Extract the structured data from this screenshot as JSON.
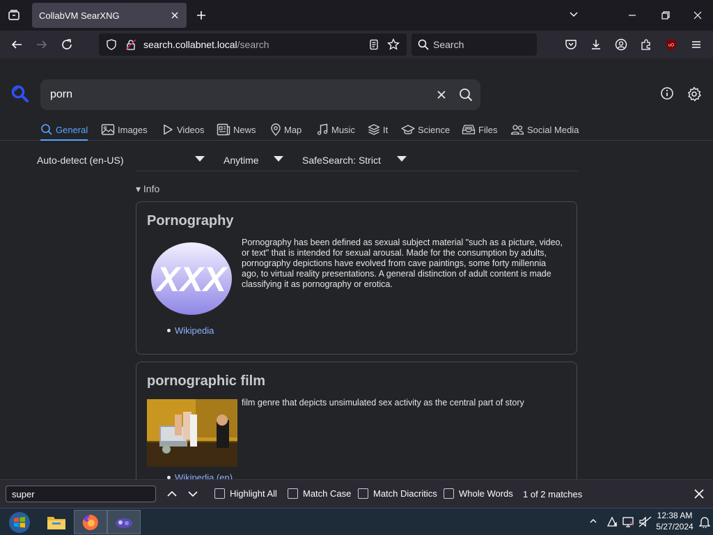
{
  "browser": {
    "tab_title": "CollabVM SearXNG",
    "url_host": "search.collabnet.local",
    "url_path": "/search",
    "search_placeholder": "Search"
  },
  "search": {
    "query": "porn"
  },
  "categories": [
    {
      "label": "General",
      "icon": "search-icon",
      "active": true
    },
    {
      "label": "Images",
      "icon": "image-icon"
    },
    {
      "label": "Videos",
      "icon": "play-icon"
    },
    {
      "label": "News",
      "icon": "newspaper-icon"
    },
    {
      "label": "Map",
      "icon": "map-pin-icon"
    },
    {
      "label": "Music",
      "icon": "music-icon"
    },
    {
      "label": "It",
      "icon": "layers-icon"
    },
    {
      "label": "Science",
      "icon": "graduation-cap-icon"
    },
    {
      "label": "Files",
      "icon": "file-tray-icon"
    },
    {
      "label": "Social Media",
      "icon": "people-icon"
    }
  ],
  "filters": {
    "language": "Auto-detect (en-US)",
    "time": "Anytime",
    "safesearch": "SafeSearch: Strict"
  },
  "info_toggle": "Info",
  "infoboxes": [
    {
      "title": "Pornography",
      "image_text": "XXX",
      "description": "Pornography has been defined as sexual subject material \"such as a picture, video, or text\" that is intended for sexual arousal. Made for the consumption by adults, pornography depictions have evolved from cave paintings, some forty millennia ago, to virtual reality presentations. A general distinction of adult content is made classifying it as pornography or erotica.",
      "link": "Wikipedia"
    },
    {
      "title": "pornographic film",
      "description": "film genre that depicts unsimulated sex activity as the central part of story",
      "link": "Wikipedia (en)"
    }
  ],
  "findbar": {
    "query": "super",
    "options": [
      "Highlight All",
      "Match Case",
      "Match Diacritics",
      "Whole Words"
    ],
    "status": "1 of 2 matches"
  },
  "taskbar": {
    "time": "12:38 AM",
    "date": "5/27/2024"
  },
  "colors": {
    "accent": "#58a6ff",
    "logo": "#3050ff",
    "link": "#8fb0ff"
  }
}
